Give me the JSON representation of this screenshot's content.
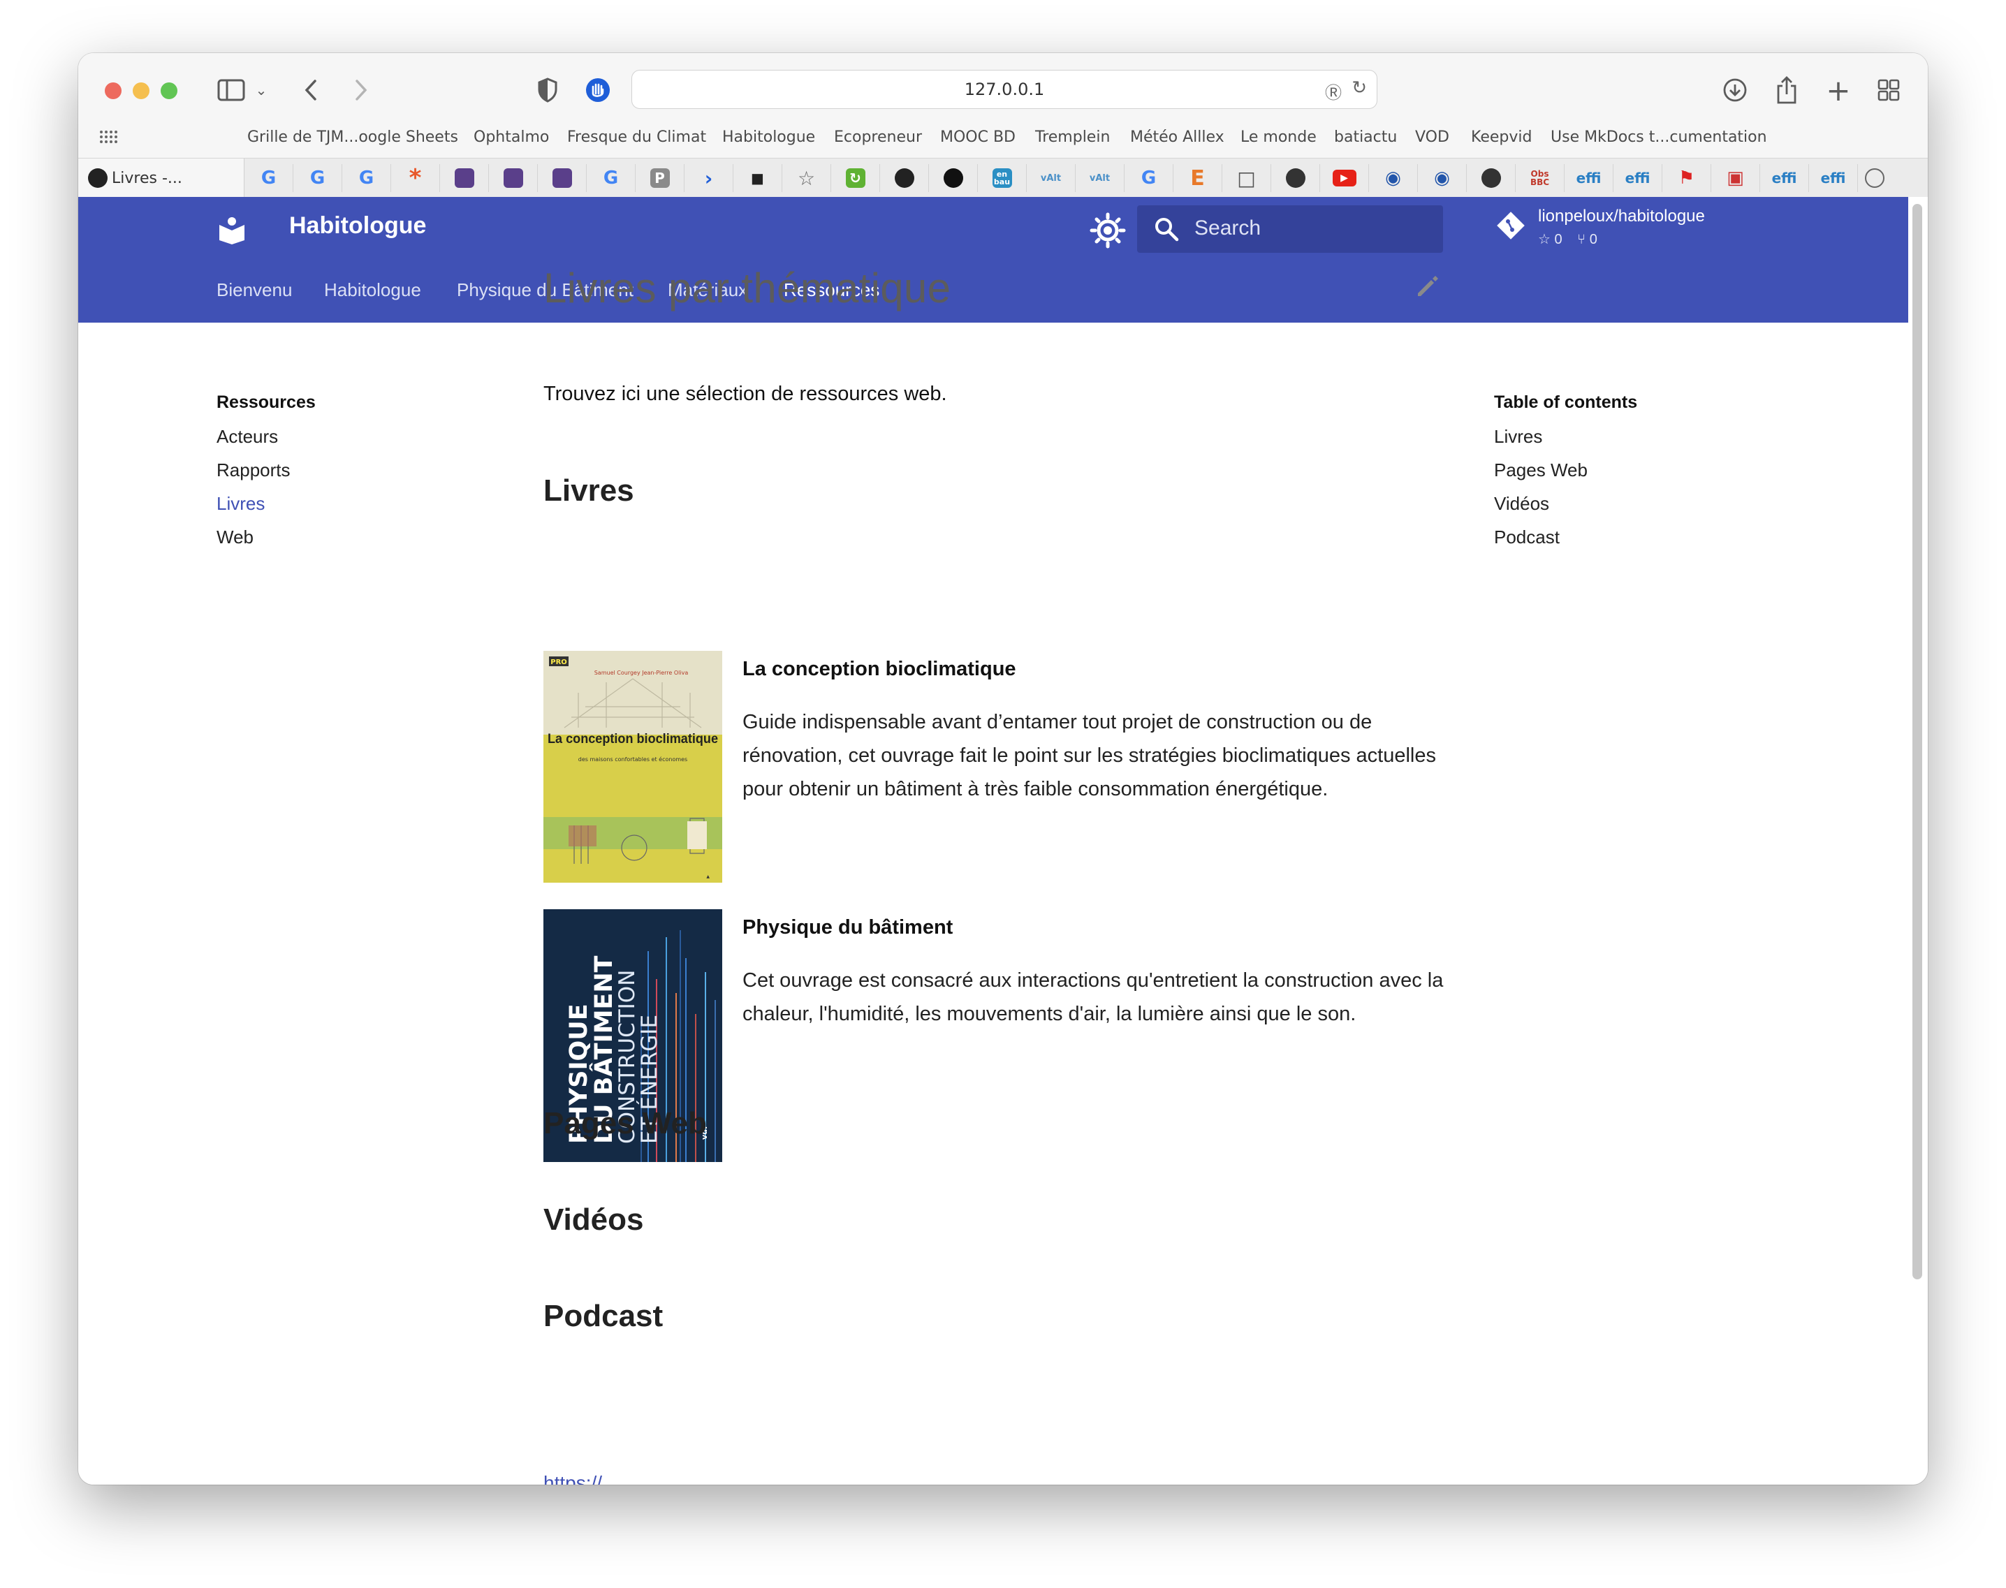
{
  "browser": {
    "url": "127.0.0.1",
    "bookmarks": [
      "Grille de TJM...oogle Sheets",
      "Ophtalmo",
      "Fresque du Climat",
      "Habitologue",
      "Ecopreneur",
      "MOOC BD",
      "Tremplein",
      "Météo Alllex",
      "Le monde",
      "batiactu",
      "VOD",
      "Keepvid",
      "Use MkDocs t...cumentation"
    ],
    "active_tab": "Livres -...",
    "pinned_tabs": [
      "G",
      "G",
      "G",
      "*",
      "",
      "",
      "",
      "G",
      "P",
      "›",
      "■",
      "☆",
      "↻",
      "●",
      "●",
      "en bau",
      "vAlt",
      "vAlt",
      "G",
      "E",
      "□",
      "●",
      "▶",
      "◉",
      "◉",
      "●",
      "Obs BBC",
      "effi",
      "effi",
      "⚑",
      "▣",
      "effi",
      "effi"
    ]
  },
  "header": {
    "site_title": "Habitologue",
    "search_placeholder": "Search",
    "repo_name": "lionpeloux/habitologue",
    "repo_stars": "☆ 0",
    "repo_forks": "⑂ 0",
    "nav": [
      "Bienvenu",
      "Habitologue",
      "Physique du Bâtiment",
      "Matériaux",
      "Ressources"
    ]
  },
  "sidebar": {
    "heading": "Ressources",
    "items": [
      "Acteurs",
      "Rapports",
      "Livres",
      "Web"
    ]
  },
  "toc": {
    "heading": "Table of contents",
    "items": [
      "Livres",
      "Pages Web",
      "Vidéos",
      "Podcast"
    ]
  },
  "content": {
    "title": "Livres par thématique",
    "intro": "Trouvez ici une sélection de ressources web.",
    "sections": [
      "Livres",
      "Pages Web",
      "Vidéos",
      "Podcast"
    ],
    "books": [
      {
        "title": "La conception bioclimatique",
        "description": "Guide indispensable avant d’entamer tout projet de construction ou de rénovation, cet ouvrage fait le point sur les stratégies bioclimatiques actuelles pour obtenir un bâtiment à très faible consommation énergétique.",
        "cover": {
          "badge": "PRO",
          "authors": "Samuel Courgey Jean-Pierre Oliva",
          "title": "La conception bioclimatique",
          "subtitle": "des maisons confortables et économes"
        }
      },
      {
        "title": "Physique du bâtiment",
        "description": "Cet ouvrage est consacré aux interactions qu'entretient la construction avec la chaleur, l'humidité, les mouvements d'air, la lumière ainsi que le son.",
        "cover": {
          "line1": "PHYSIQUE",
          "line2": "DU BÂTIMENT",
          "line3": "CONSTRUCTION",
          "line4": "ET ÉNERGIE",
          "publisher": "vdf"
        }
      }
    ],
    "podcast_link": "https://..."
  },
  "colors": {
    "primary": "#4051b5",
    "primary_dark": "#34429a",
    "link": "#4051b5"
  }
}
